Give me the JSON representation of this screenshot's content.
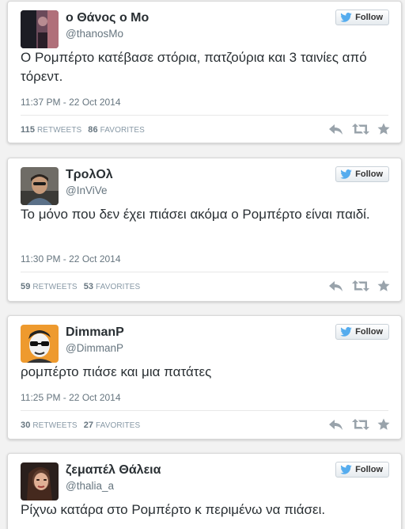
{
  "colors": {
    "background": "#f2f2f2",
    "card": "#ffffff",
    "text": "#292f33",
    "muted": "#66757f",
    "twitter_blue": "#55acee"
  },
  "follow_label": "Follow",
  "retweets_label": "RETWEETS",
  "favorites_label": "FAVORITES",
  "tweets": [
    {
      "name": "ο Θάνος ο Μο",
      "handle": "@thanosMo",
      "text": "Ο Ρομπέρτο κατέβασε στόρια, πατζούρια και 3 ταινίες από τόρεντ.",
      "time": "11:37 PM - 22 Oct 2014",
      "retweets": "115",
      "favorites": "86"
    },
    {
      "name": "ΤρολΟλ",
      "handle": "@InViVe",
      "text": "Το μόνο που δεν έχει πιάσει ακόμα ο Ρομπέρτο είναι παιδί.",
      "time": "11:30 PM - 22 Oct 2014",
      "retweets": "59",
      "favorites": "53"
    },
    {
      "name": "DimmanP",
      "handle": "@DimmanP",
      "text": "ρομπέρτο πιάσε και μια πατάτες",
      "time": "11:25 PM - 22 Oct 2014",
      "retweets": "30",
      "favorites": "27"
    },
    {
      "name": "ζεμαπέλ Θάλεια",
      "handle": "@thalia_a",
      "text": "Ρίχνω κατάρα στο Ρομπέρτο κ περιμένω να πιάσει."
    }
  ]
}
